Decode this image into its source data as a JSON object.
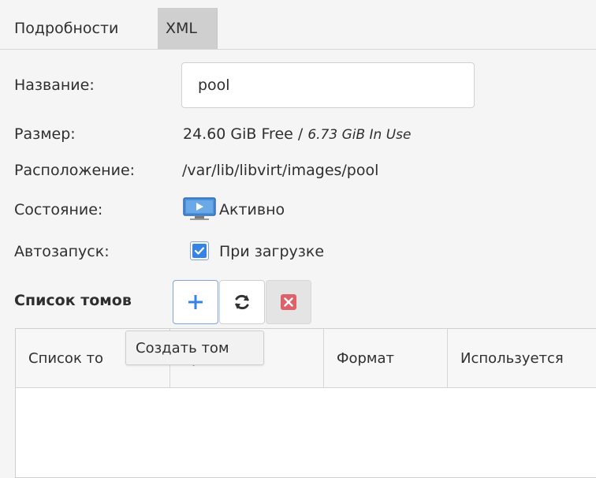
{
  "tabs": {
    "details": "Подробности",
    "xml": "XML"
  },
  "fields": {
    "name_label": "Название:",
    "name_value": "pool",
    "size_label": "Размер:",
    "size_free": "24.60 GiB Free",
    "size_sep": " / ",
    "size_in_use": "6.73 GiB In Use",
    "location_label": "Расположение:",
    "location_value": "/var/lib/libvirt/images/pool",
    "state_label": "Состояние:",
    "state_value": "Активно",
    "state_icon": "monitor-play-icon",
    "autostart_label": "Автозапуск:",
    "autostart_option": "При загрузке",
    "autostart_checked": true
  },
  "volumes": {
    "title": "Список томов",
    "buttons": [
      {
        "name": "add-volume-button",
        "icon": "plus-icon"
      },
      {
        "name": "refresh-button",
        "icon": "refresh-icon"
      },
      {
        "name": "delete-volume-button",
        "icon": "close-icon"
      }
    ],
    "tooltip": "Создать том",
    "columns": [
      "Список то",
      "ер",
      "Формат",
      "Используется"
    ]
  },
  "colors": {
    "accent": "#3584e4",
    "delete": "#e0606a",
    "tab_inactive_bg": "#cfcfcf"
  }
}
